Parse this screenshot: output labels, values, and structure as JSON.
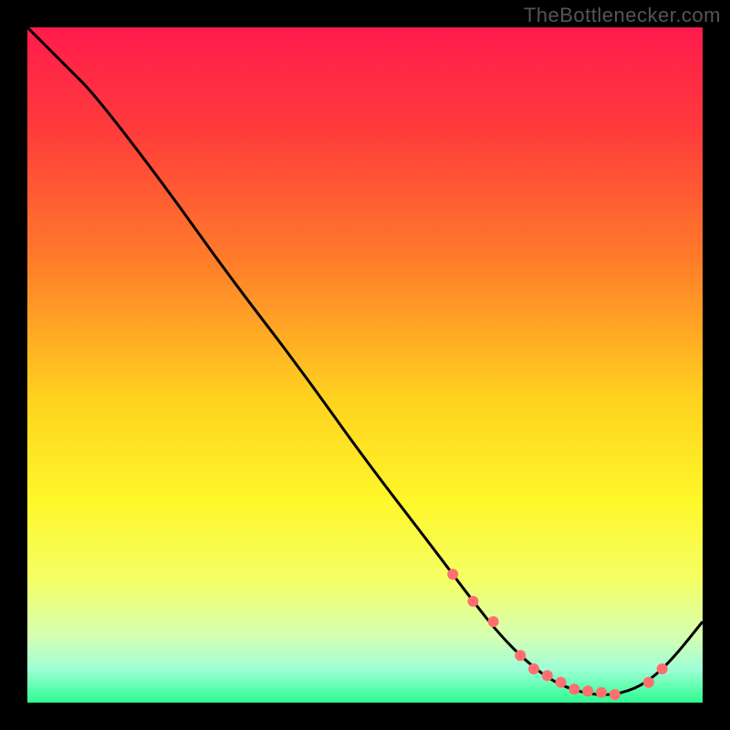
{
  "watermark": "TheBottlenecker.com",
  "colors": {
    "frame": "#000000",
    "curve": "#000000",
    "dot_fill": "#ff6f6f",
    "dot_stroke": "#ff6f6f",
    "gradient_stops": [
      {
        "offset": 0.0,
        "color": "#ff1b4d"
      },
      {
        "offset": 0.15,
        "color": "#ff3b3b"
      },
      {
        "offset": 0.35,
        "color": "#ff7e2a"
      },
      {
        "offset": 0.55,
        "color": "#ffd21f"
      },
      {
        "offset": 0.7,
        "color": "#fff72a"
      },
      {
        "offset": 0.82,
        "color": "#f4ff66"
      },
      {
        "offset": 0.9,
        "color": "#d6ffb0"
      },
      {
        "offset": 0.95,
        "color": "#9fffd6"
      },
      {
        "offset": 1.0,
        "color": "#2dfc8f"
      }
    ]
  },
  "chart_data": {
    "type": "line",
    "title": "",
    "xlabel": "",
    "ylabel": "",
    "xlim": [
      0,
      100
    ],
    "ylim": [
      0,
      100
    ],
    "series": [
      {
        "name": "bottleneck-curve",
        "x": [
          0,
          3,
          6,
          10,
          20,
          30,
          40,
          50,
          60,
          66,
          70,
          74,
          78,
          82,
          86,
          90,
          93,
          96,
          100
        ],
        "y": [
          100,
          97,
          94,
          90,
          77,
          63,
          50,
          36,
          23,
          15,
          10,
          6,
          3,
          1.5,
          1,
          2,
          4,
          7,
          12
        ]
      }
    ],
    "dots": {
      "name": "highlighted-points",
      "x": [
        63,
        66,
        69,
        73,
        75,
        77,
        79,
        81,
        83,
        85,
        87,
        92,
        94
      ],
      "y": [
        19,
        15,
        12,
        7,
        5,
        4,
        3,
        2,
        1.7,
        1.5,
        1.2,
        3,
        5
      ]
    }
  }
}
